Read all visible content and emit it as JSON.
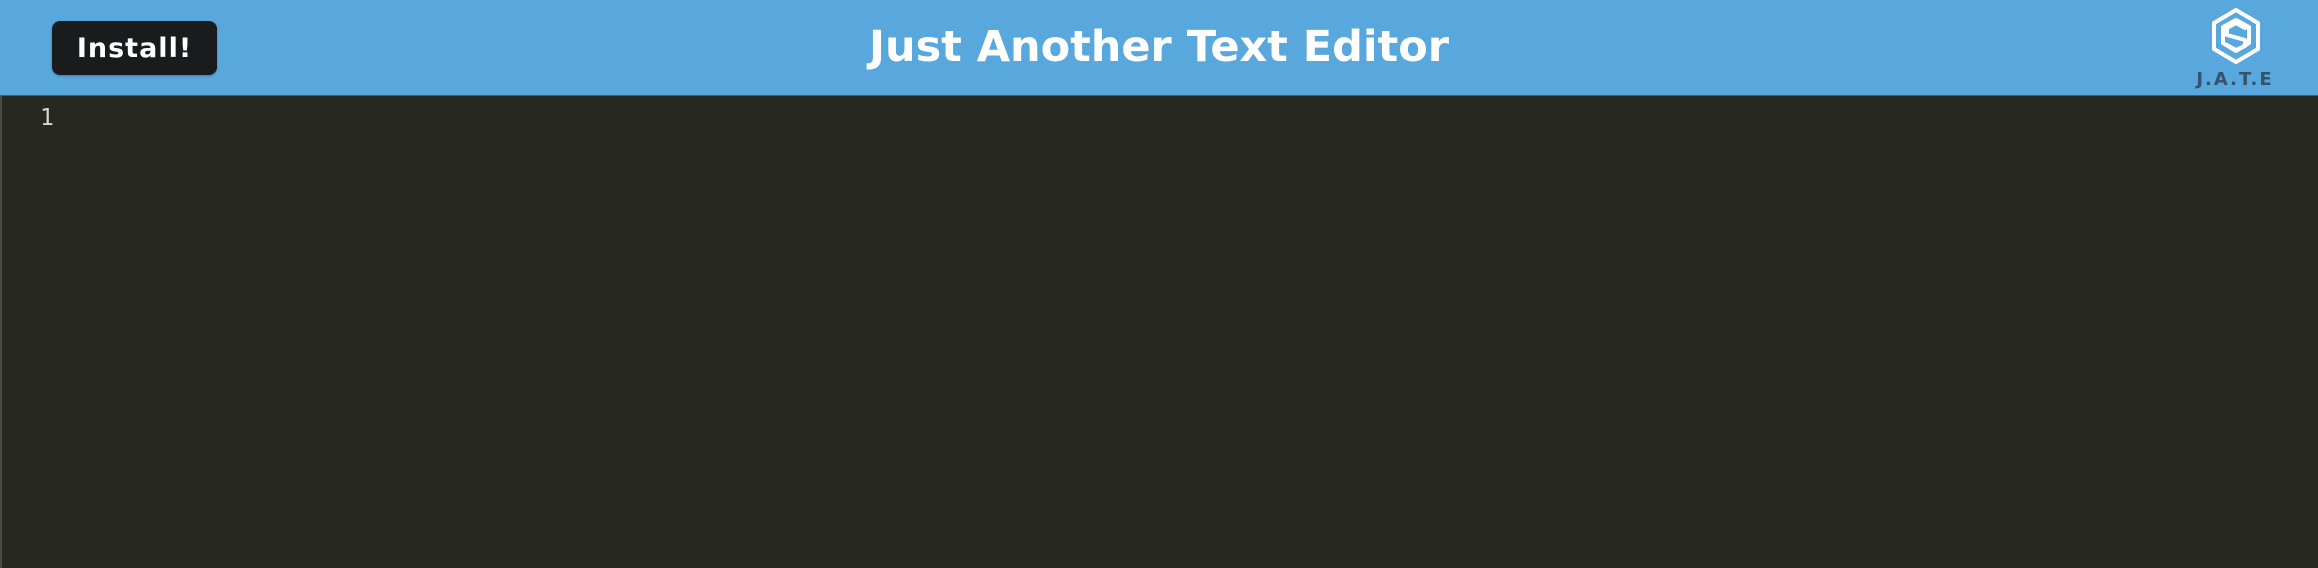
{
  "header": {
    "install_label": "Install!",
    "title": "Just Another Text Editor",
    "logo": {
      "text": "J.A.T.E",
      "icon": "hexagon-logo-icon"
    }
  },
  "editor": {
    "lines": [
      {
        "number": "1",
        "text": ""
      }
    ]
  },
  "colors": {
    "header_bg": "#58a7dd",
    "editor_bg": "#272822",
    "button_bg": "#1a1b1c",
    "line_number": "#d6d6d0"
  }
}
